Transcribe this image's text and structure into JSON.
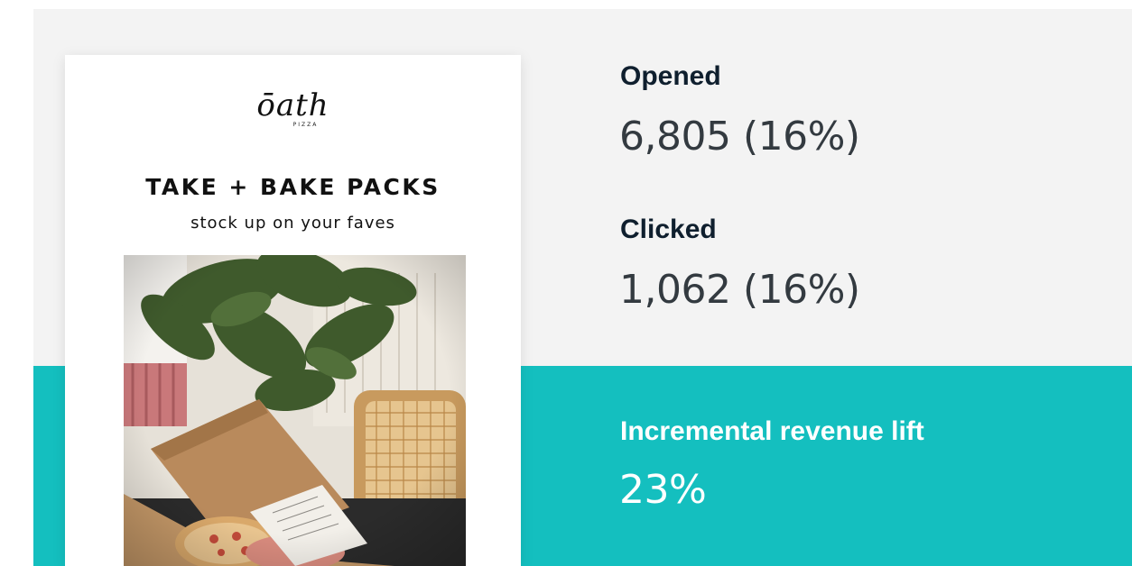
{
  "email": {
    "logo_text": "ōath",
    "logo_sub": "PIZZA",
    "headline": "TAKE + BAKE PACKS",
    "subhead": "stock up on your faves"
  },
  "stats": {
    "opened": {
      "label": "Opened",
      "value": "6,805 (16%)"
    },
    "clicked": {
      "label": "Clicked",
      "value": "1,062 (16%)"
    },
    "lift": {
      "label": "Incremental revenue lift",
      "value": "23%"
    }
  },
  "colors": {
    "accent": "#14bfbf",
    "panel": "#f3f3f3",
    "label": "#0f1f2e",
    "value": "#333a40"
  }
}
